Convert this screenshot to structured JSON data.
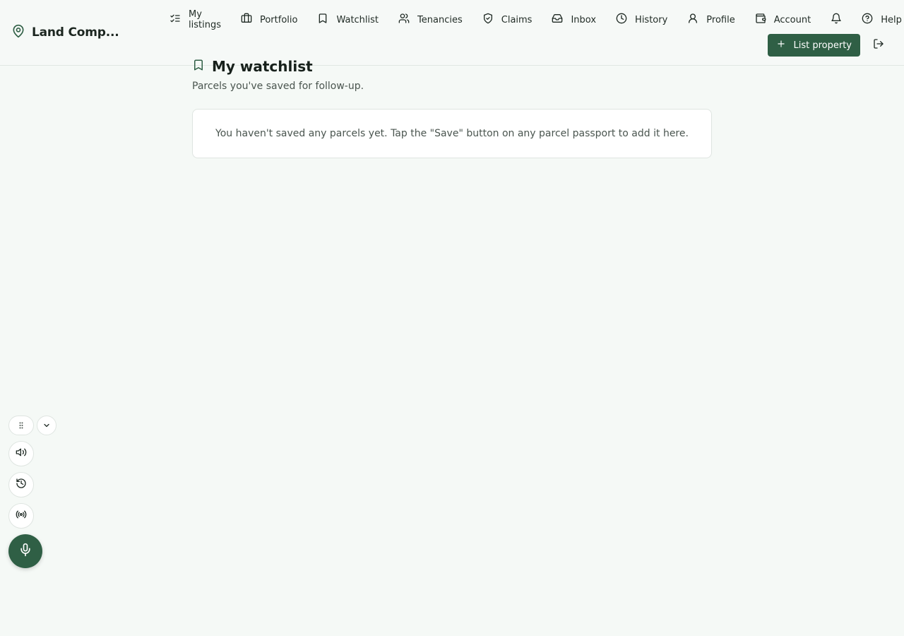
{
  "brand": {
    "name": "Land Comp...",
    "icon": "map-pin-icon"
  },
  "nav": {
    "items": [
      {
        "label": "My listings",
        "icon": "list-checks-icon"
      },
      {
        "label": "Portfolio",
        "icon": "briefcase-icon"
      },
      {
        "label": "Watchlist",
        "icon": "bookmark-icon"
      },
      {
        "label": "Tenancies",
        "icon": "users-icon"
      },
      {
        "label": "Claims",
        "icon": "shield-check-icon"
      },
      {
        "label": "Inbox",
        "icon": "inbox-icon"
      },
      {
        "label": "History",
        "icon": "clock-icon"
      },
      {
        "label": "Profile",
        "icon": "user-icon"
      },
      {
        "label": "Account",
        "icon": "wallet-icon"
      },
      {
        "label": "",
        "icon": "bell-icon"
      },
      {
        "label": "Help",
        "icon": "help-circle-icon"
      }
    ]
  },
  "actions": {
    "list_property": "List property",
    "logout_icon": "log-out-icon"
  },
  "page": {
    "title": "My watchlist",
    "subtitle": "Parcels you've saved for follow-up.",
    "empty_message": "You haven't saved any parcels yet. Tap the \"Save\" button on any parcel passport to add it here."
  },
  "floating_controls": [
    "drag-handle-icon",
    "chevron-down-icon",
    "speaker-icon",
    "history-icon",
    "broadcast-icon",
    "microphone-icon"
  ],
  "colors": {
    "accent": "#2f5f45",
    "background": "#f5f9f6",
    "card": "#ffffff"
  }
}
